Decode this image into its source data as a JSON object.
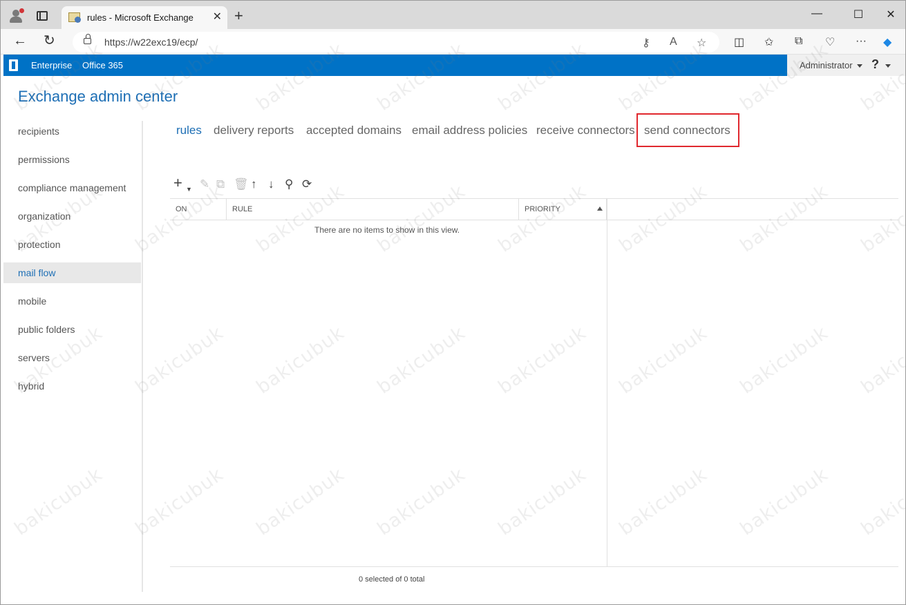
{
  "browser": {
    "tab_title": "rules - Microsoft Exchange",
    "tab_close": "✕",
    "new_tab": "+",
    "url": "https://w22exc19/ecp/",
    "win_minimize": "—",
    "win_maximize": "☐",
    "win_close": "✕"
  },
  "header": {
    "enterprise": "Enterprise",
    "office365": "Office 365",
    "user": "Administrator",
    "help": "?"
  },
  "app_title": "Exchange admin center",
  "leftnav": {
    "items": [
      {
        "label": "recipients",
        "selected": false
      },
      {
        "label": "permissions",
        "selected": false
      },
      {
        "label": "compliance management",
        "selected": false
      },
      {
        "label": "organization",
        "selected": false
      },
      {
        "label": "protection",
        "selected": false
      },
      {
        "label": "mail flow",
        "selected": true
      },
      {
        "label": "mobile",
        "selected": false
      },
      {
        "label": "public folders",
        "selected": false
      },
      {
        "label": "servers",
        "selected": false
      },
      {
        "label": "hybrid",
        "selected": false
      }
    ]
  },
  "topnav": {
    "items": [
      {
        "label": "rules",
        "selected": true
      },
      {
        "label": "delivery reports",
        "selected": false
      },
      {
        "label": "accepted domains",
        "selected": false
      },
      {
        "label": "email address policies",
        "selected": false
      },
      {
        "label": "receive connectors",
        "selected": false
      },
      {
        "label": "send connectors",
        "selected": false
      }
    ]
  },
  "grid": {
    "columns": [
      "ON",
      "RULE",
      "PRIORITY"
    ],
    "empty_message": "There are no items to show in this view.",
    "status": "0 selected of 0 total"
  },
  "watermark": "bakicubuk",
  "colors": {
    "header_blue": "#0072c6",
    "accent": "#1e6fb5",
    "highlight": "#e0282e"
  }
}
